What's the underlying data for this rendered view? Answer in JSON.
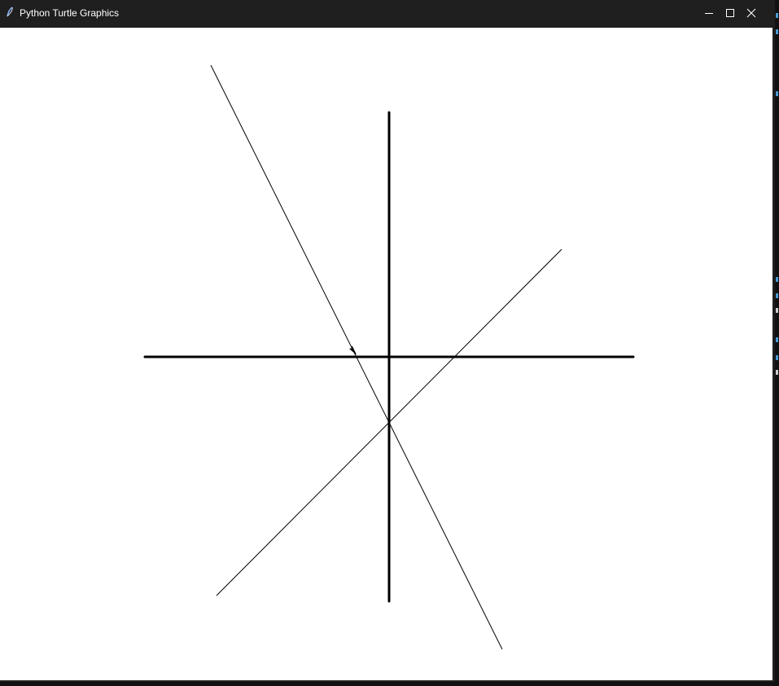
{
  "window": {
    "title": "Python Turtle Graphics",
    "app_icon": "feather-icon",
    "controls": {
      "minimize_icon": "minimize-icon",
      "maximize_icon": "maximize-icon",
      "close_icon": "close-icon"
    },
    "colors": {
      "titlebar_bg": "#1f1f1f",
      "title_text": "#ffffff",
      "canvas_bg": "#ffffff",
      "pen": "#000000",
      "editor_accent": "#4a9bd6"
    }
  },
  "canvas": {
    "turtle_icon": "arrow-cursor-icon",
    "pen_color": "#000000"
  }
}
